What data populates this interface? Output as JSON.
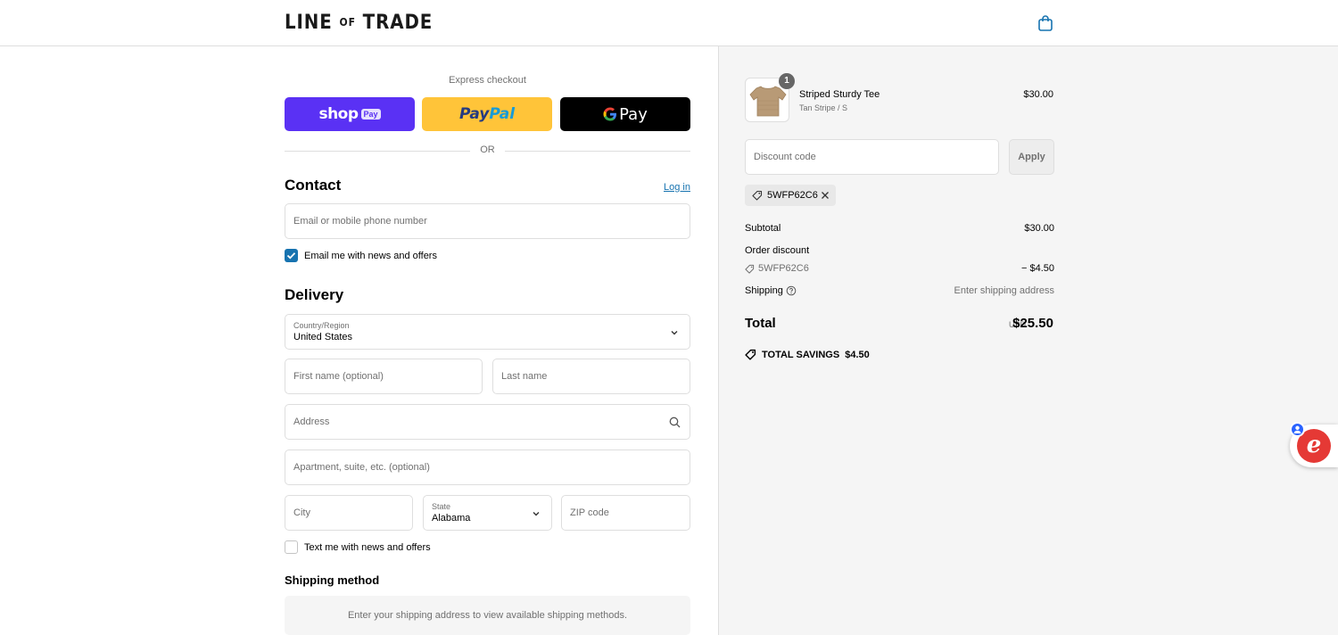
{
  "header": {
    "logo_main_left": "LINE",
    "logo_of": "OF",
    "logo_main_right": "TRADE"
  },
  "express": {
    "title": "Express checkout",
    "shop_pay": "shop",
    "shop_pay_badge": "Pay",
    "paypal_left": "Pay",
    "paypal_right": "Pal",
    "gpay": "Pay",
    "or": "OR"
  },
  "contact": {
    "title": "Contact",
    "login": "Log in",
    "email_placeholder": "Email or mobile phone number",
    "news_checkbox": "Email me with news and offers",
    "news_checked": true
  },
  "delivery": {
    "title": "Delivery",
    "country_label": "Country/Region",
    "country_value": "United States",
    "first_name_placeholder": "First name (optional)",
    "last_name_placeholder": "Last name",
    "address_placeholder": "Address",
    "apartment_placeholder": "Apartment, suite, etc. (optional)",
    "city_placeholder": "City",
    "state_label": "State",
    "state_value": "Alabama",
    "zip_placeholder": "ZIP code",
    "text_checkbox": "Text me with news and offers",
    "text_checked": false
  },
  "shipping_method": {
    "title": "Shipping method",
    "message": "Enter your shipping address to view available shipping methods."
  },
  "order": {
    "item": {
      "quantity": "1",
      "name": "Striped Sturdy Tee",
      "variant": "Tan Stripe / S",
      "price": "$30.00"
    },
    "discount_placeholder": "Discount code",
    "apply": "Apply",
    "applied_code": "5WFP62C6",
    "subtotal_label": "Subtotal",
    "subtotal_value": "$30.00",
    "order_discount_label": "Order discount",
    "discount_code": "5WFP62C6",
    "discount_value": "− $4.50",
    "shipping_label": "Shipping",
    "shipping_value": "Enter shipping address",
    "total_label": "Total",
    "total_currency": "USD",
    "total_value": "$25.50",
    "savings_label": "TOTAL SAVINGS",
    "savings_value": "$4.50"
  },
  "widget": {
    "letter": "e"
  },
  "colors": {
    "accent": "#1773b0",
    "shop_pay": "#5a31f4",
    "paypal": "#ffc439",
    "gpay": "#000000",
    "widget": "#e53935"
  }
}
